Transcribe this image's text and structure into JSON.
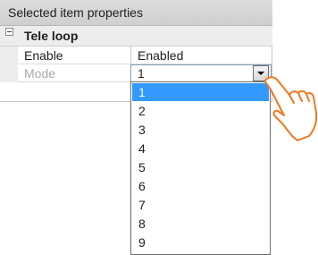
{
  "panel": {
    "title": "Selected item properties"
  },
  "category": {
    "label": "Tele loop",
    "toggle_symbol": "minus",
    "expanded": true
  },
  "properties": [
    {
      "name": "Enable",
      "value": "Enabled",
      "disabled": false
    },
    {
      "name": "Mode",
      "value": "1",
      "disabled": true
    }
  ],
  "dropdown": {
    "selected": "1",
    "options": [
      "1",
      "2",
      "3",
      "4",
      "5",
      "6",
      "7",
      "8",
      "9"
    ]
  },
  "colors": {
    "selection": "#3399ff",
    "disabled_text": "#a8a8a8",
    "hand_outline": "#f07820",
    "header_bg": "#d6d6d6"
  },
  "icons": {
    "collapse_toggle": "minus-box-icon",
    "dropdown_arrow": "chevron-down-icon",
    "pointer_hand": "pointing-hand-icon"
  }
}
